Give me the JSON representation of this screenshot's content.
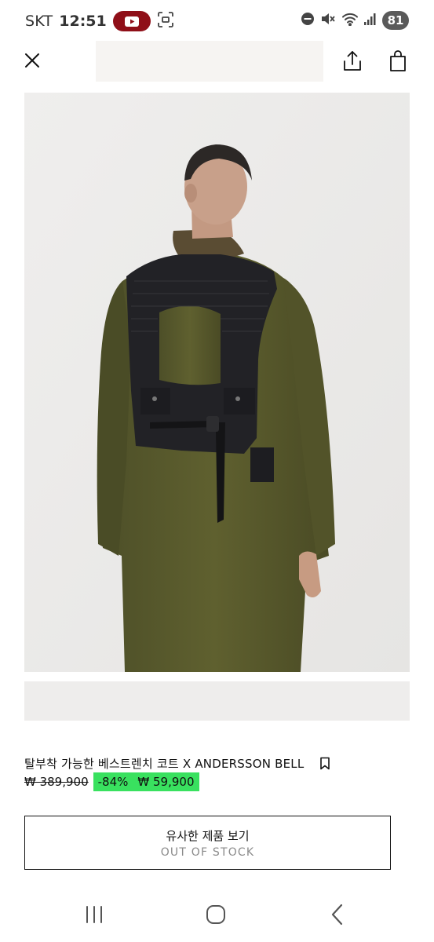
{
  "status_bar": {
    "carrier": "SKT",
    "time": "12:51",
    "battery": "81",
    "icons": [
      "youtube-icon",
      "screenshot-icon",
      "do-not-disturb-icon",
      "mute-icon",
      "wifi-icon",
      "signal-icon"
    ]
  },
  "top_bar": {
    "icons": [
      "close-icon",
      "share-icon",
      "shopping-bag-icon"
    ]
  },
  "product": {
    "title": "탈부착 가능한 베스트렌치 코트 X ANDERSSON BELL",
    "original_price": "₩ 389,900",
    "discount": "-84%",
    "sale_price": "₩ 59,900",
    "bookmark_icon": "bookmark-icon"
  },
  "similar_button": {
    "label": "유사한 제품 보기",
    "status": "OUT OF STOCK"
  },
  "nav_bar": {
    "icons": [
      "recent-apps-icon",
      "home-icon",
      "back-icon"
    ]
  },
  "colors": {
    "sale_highlight": "#39e15f",
    "youtube_red": "#8f0f18",
    "coat": "#58592d",
    "vest": "#232326"
  }
}
